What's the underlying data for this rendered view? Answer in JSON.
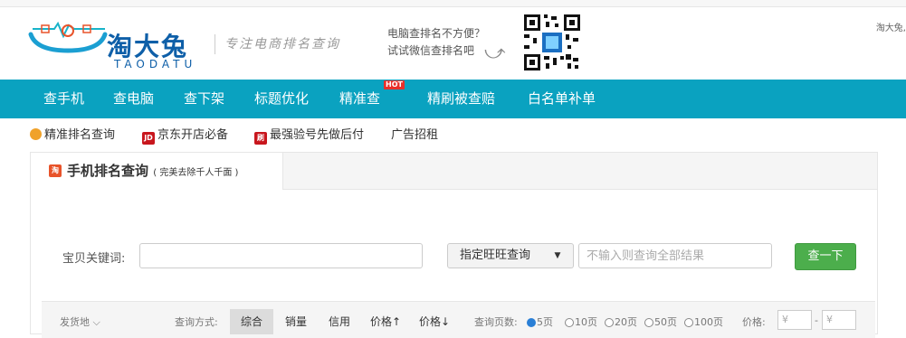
{
  "header": {
    "logo_cn": "淘大兔",
    "logo_en": "TAODATU",
    "slogan": "专注电商排名查询",
    "tip_line1": "电脑查排名不方便？",
    "tip_line2": "试试微信查排名吧",
    "user": "淘大兔,",
    "brand_color": "#0aa2c0"
  },
  "nav": {
    "items": [
      "查手机",
      "查电脑",
      "查下架",
      "标题优化",
      "精准查",
      "精刷被查赔",
      "白名单补单"
    ],
    "hot_badge": "HOT"
  },
  "subnav": {
    "items": [
      {
        "icon": "coin-icon",
        "label": "精准排名查询"
      },
      {
        "icon": "jd-icon",
        "icon_text": "JD",
        "label": "京东开店必备"
      },
      {
        "icon": "brush-icon",
        "icon_text": "刷",
        "label": "最强验号先做后付"
      },
      {
        "label": "广告招租"
      }
    ]
  },
  "panel": {
    "tab_icon_text": "淘",
    "tab_title": "手机排名查询",
    "tab_note": "( 完美去除千人千面 )",
    "keyword_label": "宝贝关键词:",
    "keyword_value": "",
    "wangwang_button": "指定旺旺查询",
    "wangwang_caret": "▼",
    "wangwang_placeholder": "不输入则查询全部结果",
    "search_button": "查一下"
  },
  "filter": {
    "ship_from": "发货地",
    "method_label": "查询方式:",
    "sort_options": [
      "综合",
      "销量",
      "信用",
      "价格↑",
      "价格↓"
    ],
    "active_sort": "综合",
    "pages_label": "查询页数:",
    "page_options": [
      "5页",
      "10页",
      "20页",
      "50页",
      "100页"
    ],
    "selected_pages": "5页",
    "price_label": "价格:",
    "price_min_placeholder": "¥",
    "price_max_placeholder": "¥",
    "price_sep": "-"
  }
}
